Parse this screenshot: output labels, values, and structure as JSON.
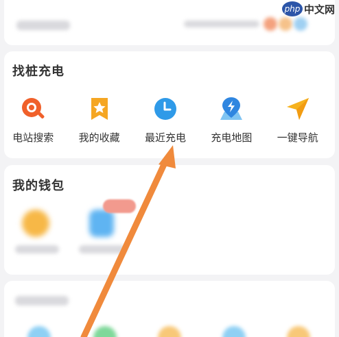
{
  "watermark": {
    "logo": "php",
    "text": "中文网"
  },
  "charge_section": {
    "title": "找桩充电",
    "items": [
      {
        "label": "电站搜索",
        "icon": "station-search-icon",
        "color": "#f0602a"
      },
      {
        "label": "我的收藏",
        "icon": "favorites-star-icon",
        "color": "#f5a623"
      },
      {
        "label": "最近充电",
        "icon": "recent-clock-icon",
        "color": "#2f9ae8"
      },
      {
        "label": "充电地图",
        "icon": "charge-map-icon",
        "color": "#2f86e0"
      },
      {
        "label": "一键导航",
        "icon": "navigation-arrow-icon",
        "color": "#f6b21e"
      }
    ]
  },
  "wallet_section": {
    "title": "我的钱包"
  },
  "colors": {
    "accent_arrow": "#f08a3c",
    "background": "#f3f3f5",
    "card": "#ffffff"
  }
}
